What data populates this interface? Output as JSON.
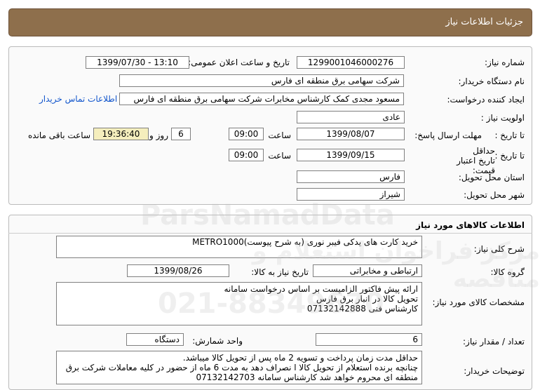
{
  "header": {
    "title": "جزئیات اطلاعات نیاز"
  },
  "need_info": {
    "need_number_label": "شماره نیاز:",
    "need_number": "1299001046000276",
    "announce_label": "تاریخ و ساعت اعلان عمومی:",
    "announce_value": "1399/07/30 - 13:10",
    "buyer_label": "نام دستگاه خریدار:",
    "buyer_value": "شرکت سهامی برق منطقه ای فارس",
    "requester_label": "ایجاد کننده درخواست:",
    "requester_value": "مسعود مجدی کمک کارشناس مخابرات شرکت سهامی برق منطقه ای فارس",
    "contact_link": "اطلاعات تماس خریدار",
    "priority_label": "اولویت نیاز :",
    "priority_value": "عادی",
    "deadline_label": "مهلت ارسال پاسخ:",
    "to_date_label": "تا تاریخ :",
    "deadline_date": "1399/08/07",
    "time_label": "ساعت",
    "deadline_time": "09:00",
    "days_value": "6",
    "days_label": "روز و",
    "remaining_time": "19:36:40",
    "remaining_label": "ساعت باقی مانده",
    "validity_label": "حداقل تاریخ اعتبار قیمت:",
    "validity_date": "1399/09/15",
    "validity_time": "09:00",
    "province_label": "استان محل تحویل:",
    "province_value": "فارس",
    "city_label": "شهر محل تحویل:",
    "city_value": "شیراز"
  },
  "goods": {
    "section_title": "اطلاعات کالاهای مورد نیاز",
    "summary_label": "شرح کلی نیاز:",
    "summary_value": "خرید  کارت های یدکی فیبر نوری   (به شرح پیوست)METRO1000",
    "group_label": "گروه کالا:",
    "group_value": "ارتباطی و مخابراتی",
    "need_date_label": "تاریخ نیاز به کالا:",
    "need_date_value": "1399/08/26",
    "specs_label": "مشخصات کالای مورد نیاز:",
    "specs_lines": [
      "ارائه پیش فاکتور الزامیست بر اساس  درخواست سامانه",
      "تحویل کالا در انبار برق فارس",
      "کارشناس فنی 07132142888"
    ],
    "qty_label": "تعداد / مقدار نیاز:",
    "qty_value": "6",
    "unit_label": "واحد شمارش:",
    "unit_value": "دستگاه",
    "notes_label": "توضیحات خریدار:",
    "notes_lines": [
      "حداقل مدت زمان پرداخت و تسویه 2 ماه پس از تحویل کالا میباشد.",
      "چنانچه برنده استعلام از تحویل کالا ا نصراف دهد به مدت 6 ماه از حضور در کلیه معاملات شرکت برق",
      "منطقه ای محروم خواهد شد کارشناس سامانه 07132142703"
    ]
  },
  "watermark": {
    "brand": "ParsNamadData",
    "fa_text": "مرکز فراخوان استعلام و مناقصه",
    "phone": "021-88349670"
  }
}
